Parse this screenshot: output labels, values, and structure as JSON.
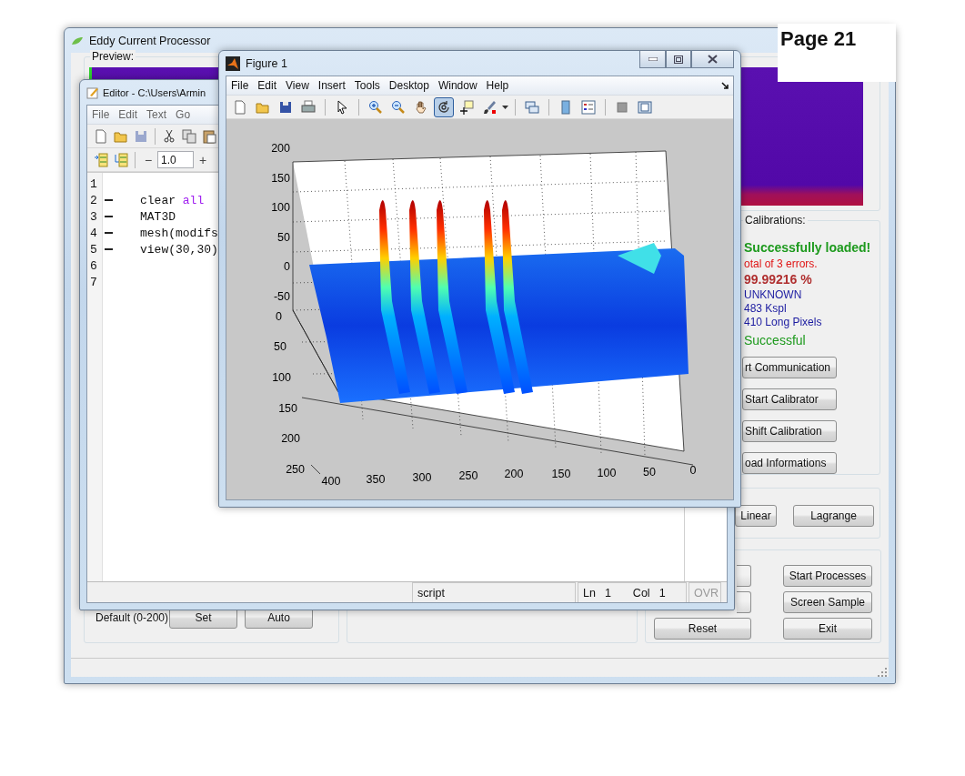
{
  "page_label": "Page 21",
  "main_window": {
    "title": "Eddy Current Processor",
    "preview_label": "Preview:",
    "calibrations_label": "Calibrations:",
    "status_lines": [
      {
        "text": "Successfully loaded!",
        "kind": "headline"
      },
      {
        "text": "otal of 3 errors.",
        "kind": "error"
      },
      {
        "text": "99.99216 %",
        "kind": "percent"
      },
      {
        "text": "UNKNOWN",
        "kind": "info"
      },
      {
        "text": "483 Kspl",
        "kind": "info"
      },
      {
        "text": "410 Long Pixels",
        "kind": "info"
      },
      {
        "text": "Successful",
        "kind": "success"
      }
    ],
    "calibration_buttons": [
      "rt Communication",
      "Start Calibrator",
      "Shift Calibration",
      "oad Informations"
    ],
    "interpolation_buttons": [
      "Linear",
      "Lagrange"
    ],
    "range_label": "Default (0-200)",
    "range_buttons": [
      "Set",
      "Auto"
    ],
    "process_buttons": [
      "Start Processes",
      "Screen Sample",
      "Reset",
      "Exit"
    ]
  },
  "editor": {
    "title": "Editor - C:\\Users\\Armin",
    "menu": [
      "File",
      "Edit",
      "Text",
      "Go"
    ],
    "tools": [
      {
        "kind": "new",
        "disabled": false
      },
      {
        "kind": "open",
        "disabled": false
      },
      {
        "kind": "save",
        "disabled": true
      },
      {
        "kind": "cut",
        "disabled": false
      },
      {
        "kind": "copy",
        "disabled": false
      },
      {
        "kind": "paste",
        "disabled": false
      }
    ],
    "cell_tools": [
      {
        "kind": "insert-cell"
      },
      {
        "kind": "evaluate-cell"
      }
    ],
    "zoom": {
      "minus": "−",
      "value": "1.0",
      "plus": "+"
    },
    "lines": [
      {
        "number": "1",
        "executable": false
      },
      {
        "number": "2",
        "executable": true,
        "tokens": [
          {
            "text": "clear ",
            "kind": "plain"
          },
          {
            "text": "all",
            "kind": "keyword"
          }
        ]
      },
      {
        "number": "3",
        "executable": true,
        "tokens": [
          {
            "text": "MAT3D",
            "kind": "plain"
          }
        ]
      },
      {
        "number": "4",
        "executable": true,
        "tokens": [
          {
            "text": "mesh(modifs",
            "kind": "plain"
          }
        ]
      },
      {
        "number": "5",
        "executable": true,
        "tokens": [
          {
            "text": "view(30,30)",
            "kind": "plain"
          }
        ]
      },
      {
        "number": "6",
        "executable": false
      },
      {
        "number": "7",
        "executable": false
      }
    ],
    "status": {
      "mode": "script",
      "fields": [
        {
          "label": "Ln",
          "value": "1"
        },
        {
          "label": "Col",
          "value": "1"
        }
      ],
      "overwrite": "OVR"
    }
  },
  "figure": {
    "title": "Figure 1",
    "menu": [
      "File",
      "Edit",
      "View",
      "Insert",
      "Tools",
      "Desktop",
      "Window",
      "Help"
    ],
    "tool_groups": [
      {
        "tools": [
          {
            "kind": "new",
            "selected": false
          },
          {
            "kind": "open",
            "selected": false
          },
          {
            "kind": "save",
            "selected": false
          },
          {
            "kind": "print",
            "selected": false
          }
        ]
      },
      {
        "tools": [
          {
            "kind": "pointer",
            "selected": false
          }
        ]
      },
      {
        "tools": [
          {
            "kind": "zoom-in",
            "selected": false
          },
          {
            "kind": "zoom-out",
            "selected": false
          },
          {
            "kind": "pan",
            "selected": false
          },
          {
            "kind": "rotate",
            "selected": true
          },
          {
            "kind": "data-cursor",
            "selected": false
          },
          {
            "kind": "brush",
            "selected": false
          }
        ]
      },
      {
        "tools": [
          {
            "kind": "link",
            "selected": false
          }
        ]
      },
      {
        "tools": [
          {
            "kind": "colorbar",
            "selected": false
          },
          {
            "kind": "legend",
            "selected": false
          }
        ]
      },
      {
        "tools": [
          {
            "kind": "hide",
            "selected": false
          },
          {
            "kind": "show",
            "selected": false
          }
        ]
      }
    ],
    "plot": {
      "z_ticks": [
        "200",
        "150",
        "100",
        "50",
        "0",
        "-50"
      ],
      "y_ticks": [
        "0",
        "50",
        "100",
        "150",
        "200",
        "250"
      ],
      "x_ticks": [
        "400",
        "350",
        "300",
        "250",
        "200",
        "150",
        "100",
        "50",
        "0"
      ]
    }
  }
}
